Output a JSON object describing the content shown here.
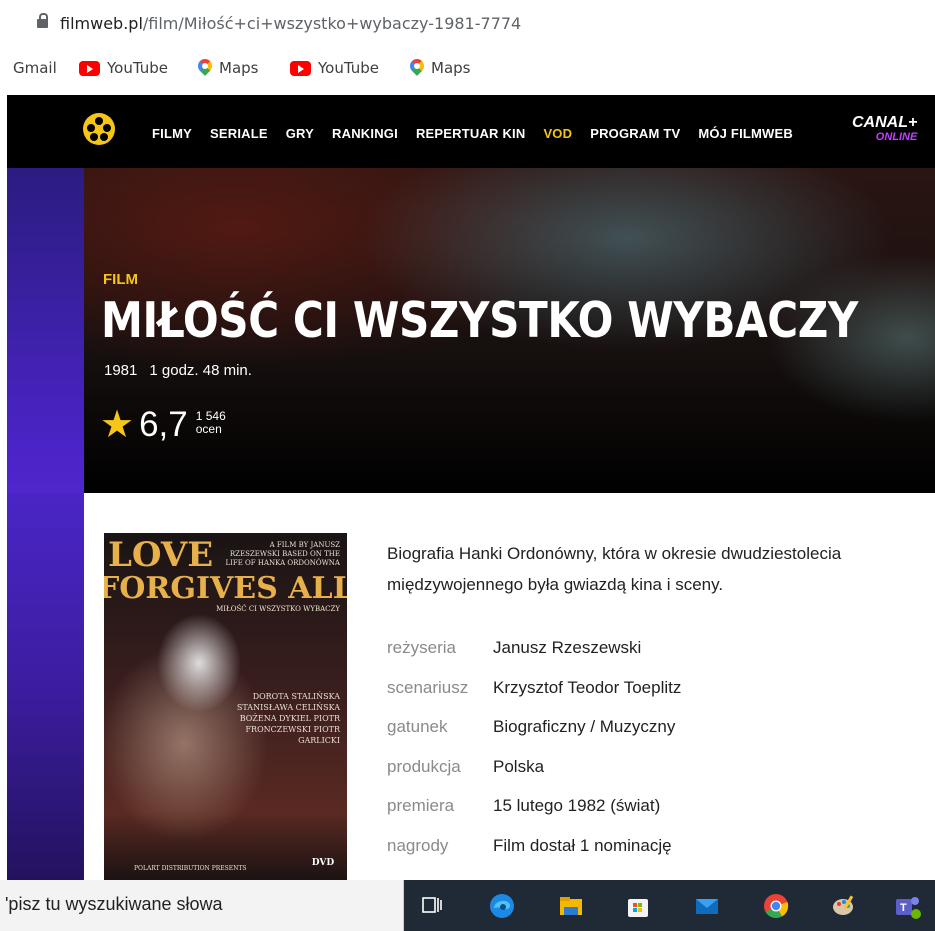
{
  "browser": {
    "url_domain": "filmweb.pl",
    "url_path": "/film/Miłość+ci+wszystko+wybaczy-1981-7774",
    "bookmarks": [
      "Gmail",
      "YouTube",
      "Maps",
      "YouTube",
      "Maps"
    ]
  },
  "nav": {
    "items": [
      "FILMY",
      "SERIALE",
      "GRY",
      "RANKINGI",
      "REPERTUAR KIN",
      "VOD",
      "PROGRAM TV",
      "MÓJ FILMWEB"
    ],
    "canal": "CANAL+",
    "canal_sub": "ONLINE"
  },
  "film": {
    "kind": "FILM",
    "title": "MIŁOŚĆ CI WSZYSTKO WYBACZY",
    "year": "1981",
    "duration": "1 godz. 48 min.",
    "rating": "6,7",
    "votes": "1 546",
    "votes_label": "ocen",
    "description": "Biografia Hanki Ordonówny, która w okresie dwudziestolecia międzywojennego była gwiazdą kina i sceny."
  },
  "poster": {
    "title_line1": "LOVE",
    "title_line2": "FORGIVES ALL",
    "credit": "A FILM BY JANUSZ RZESZEWSKI BASED ON THE LIFE OF HANKA ORDONÓWNA",
    "subtitle": "MIŁOŚĆ CI WSZYSTKO WYBACZY",
    "cast": "DOROTA STALIŃSKA STANISŁAWA CELIŃSKA BOŻENA DYKIEL PIOTR FRONCZEWSKI PIOTR GARLICKI",
    "footer": "POLART DISTRIBUTION PRESENTS",
    "badge": "DVD"
  },
  "details": [
    {
      "key": "reżyseria",
      "value": "Janusz Rzeszewski"
    },
    {
      "key": "scenariusz",
      "value": "Krzysztof Teodor Toeplitz"
    },
    {
      "key": "gatunek",
      "value": "Biograficzny / Muzyczny"
    },
    {
      "key": "produkcja",
      "value": "Polska"
    },
    {
      "key": "premiera",
      "value": "15 lutego 1982 (świat)"
    },
    {
      "key": "nagrody",
      "value": "Film dostał 1 nominację"
    }
  ],
  "taskbar": {
    "search_text": "'pisz tu wyszukiwane słowa",
    "icons": [
      "task-view-icon",
      "edge-icon",
      "file-explorer-icon",
      "store-icon",
      "mail-icon",
      "chrome-icon",
      "paint-icon",
      "teams-icon"
    ]
  }
}
